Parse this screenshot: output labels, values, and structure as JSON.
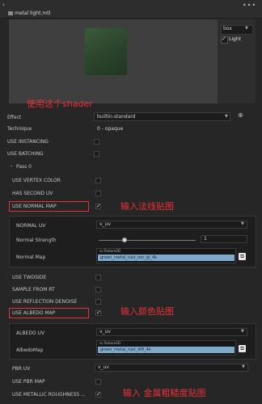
{
  "header": {
    "title": "metal light.mtl",
    "more_icon": "ellipsis-icon"
  },
  "preview": {
    "primitive": "box",
    "light_label": "Light",
    "light_checked": true
  },
  "annotations": {
    "shader": "使用这个shader",
    "normal": "输入法线贴图",
    "albedo": "输入颜色贴图",
    "metal": "输入 金属粗糙度贴图"
  },
  "effect": {
    "label": "Effect",
    "value": "builtin-standard"
  },
  "technique": {
    "label": "Technique",
    "value": "0 - opaque"
  },
  "use_instancing": {
    "label": "USE INSTANCING",
    "checked": false
  },
  "use_batching": {
    "label": "USE BATCHING",
    "checked": false
  },
  "pass": {
    "label": "Pass 0"
  },
  "use_vertex_color": {
    "label": "USE VERTEX COLOR",
    "checked": false
  },
  "has_second_uv": {
    "label": "HAS SECOND UV",
    "checked": false
  },
  "use_normal_map": {
    "label": "USE NORMAL MAP",
    "checked": true
  },
  "normal_uv": {
    "label": "NORMAL UV",
    "value": "v_uv"
  },
  "normal_strength": {
    "label": "Normal Strength",
    "value": "1",
    "fraction": 0.27
  },
  "normal_map": {
    "label": "Normal Map",
    "type": "cc.Texture2D",
    "name": "green_metal_rust_nor_gl_4k"
  },
  "use_twoside": {
    "label": "USE TWOSIDE",
    "checked": false
  },
  "sample_from_rt": {
    "label": "SAMPLE FROM RT",
    "checked": false
  },
  "use_reflection_denoise": {
    "label": "USE REFLECTION DENOISE",
    "checked": false
  },
  "use_albedo_map": {
    "label": "USE ALBEDO MAP",
    "checked": true
  },
  "albedo_uv": {
    "label": "ALBEDO UV",
    "value": "v_uv"
  },
  "albedo_map": {
    "label": "AlbedoMap",
    "type": "cc.Texture2D",
    "name": "green_metal_rust_diff_4k"
  },
  "pbr_uv": {
    "label": "PBR UV",
    "value": "v_uv"
  },
  "use_pbr_map": {
    "label": "USE PBR MAP",
    "checked": false
  },
  "use_metallic_roughness": {
    "label": "USE METALLIC ROUGHNESS ...",
    "checked": true
  }
}
